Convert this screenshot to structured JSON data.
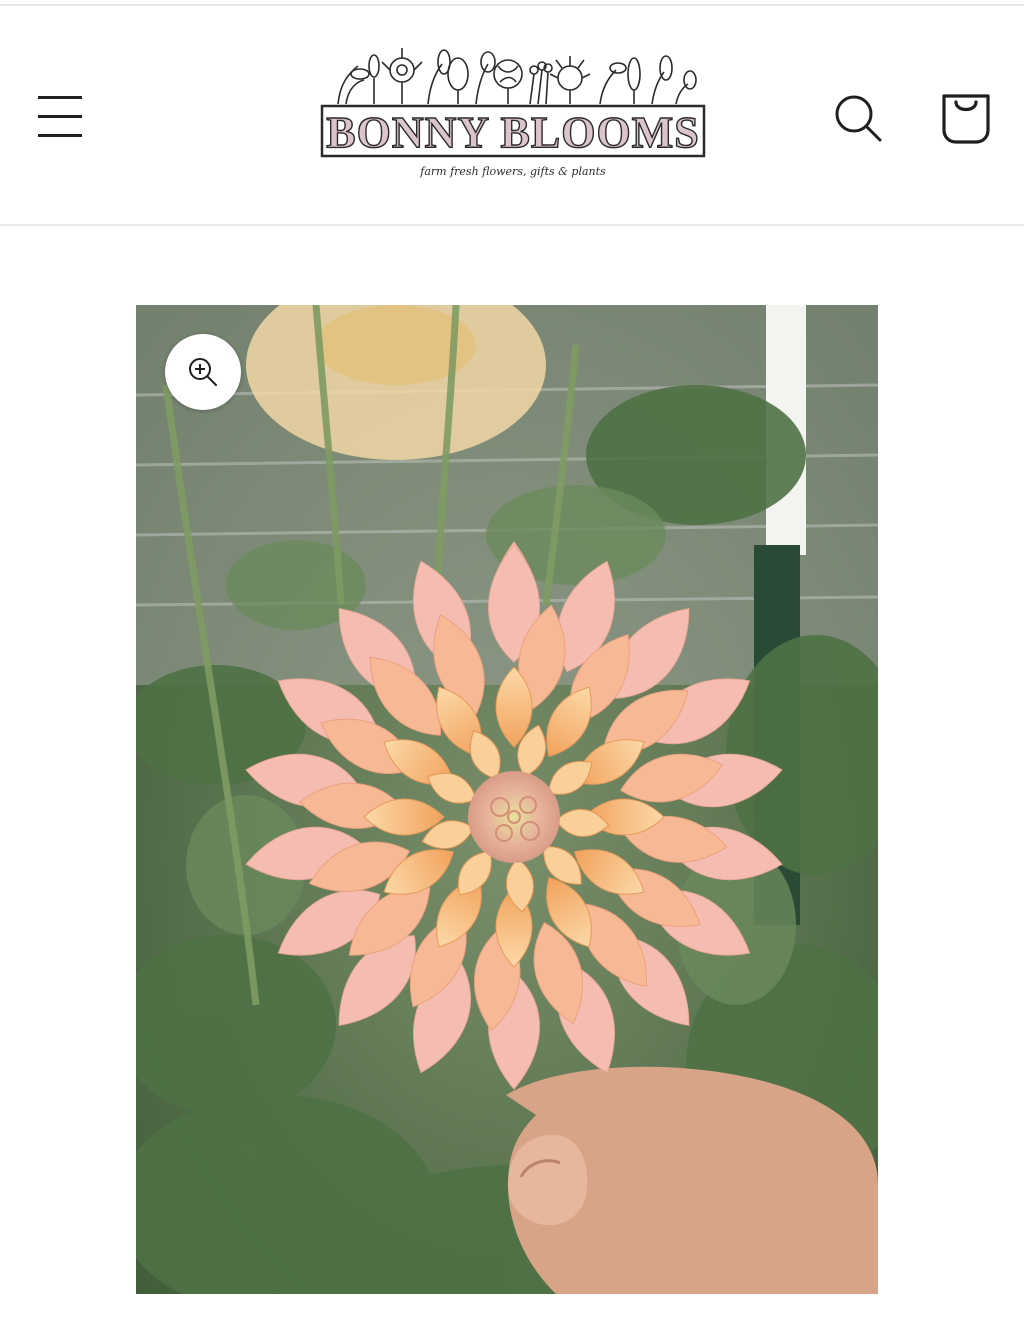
{
  "store": {
    "logo_title": "BONNY BLOOMS",
    "logo_tagline": "farm fresh flowers, gifts & plants"
  },
  "header": {
    "icons": {
      "menu": "hamburger-menu-icon",
      "search": "search-icon",
      "cart": "cart-bag-icon"
    }
  },
  "product": {
    "gallery": {
      "current_image": "peach-dahlia-photo",
      "zoom_icon": "zoom-in-icon"
    }
  },
  "colors": {
    "text_dark": "#1f1f1f",
    "logo_title_fill": "#dcc4cc",
    "logo_outline": "#2b2b2b",
    "petal_peach": "#f6b592",
    "petal_pink": "#f5c2c0",
    "foliage": "#4f7145"
  }
}
